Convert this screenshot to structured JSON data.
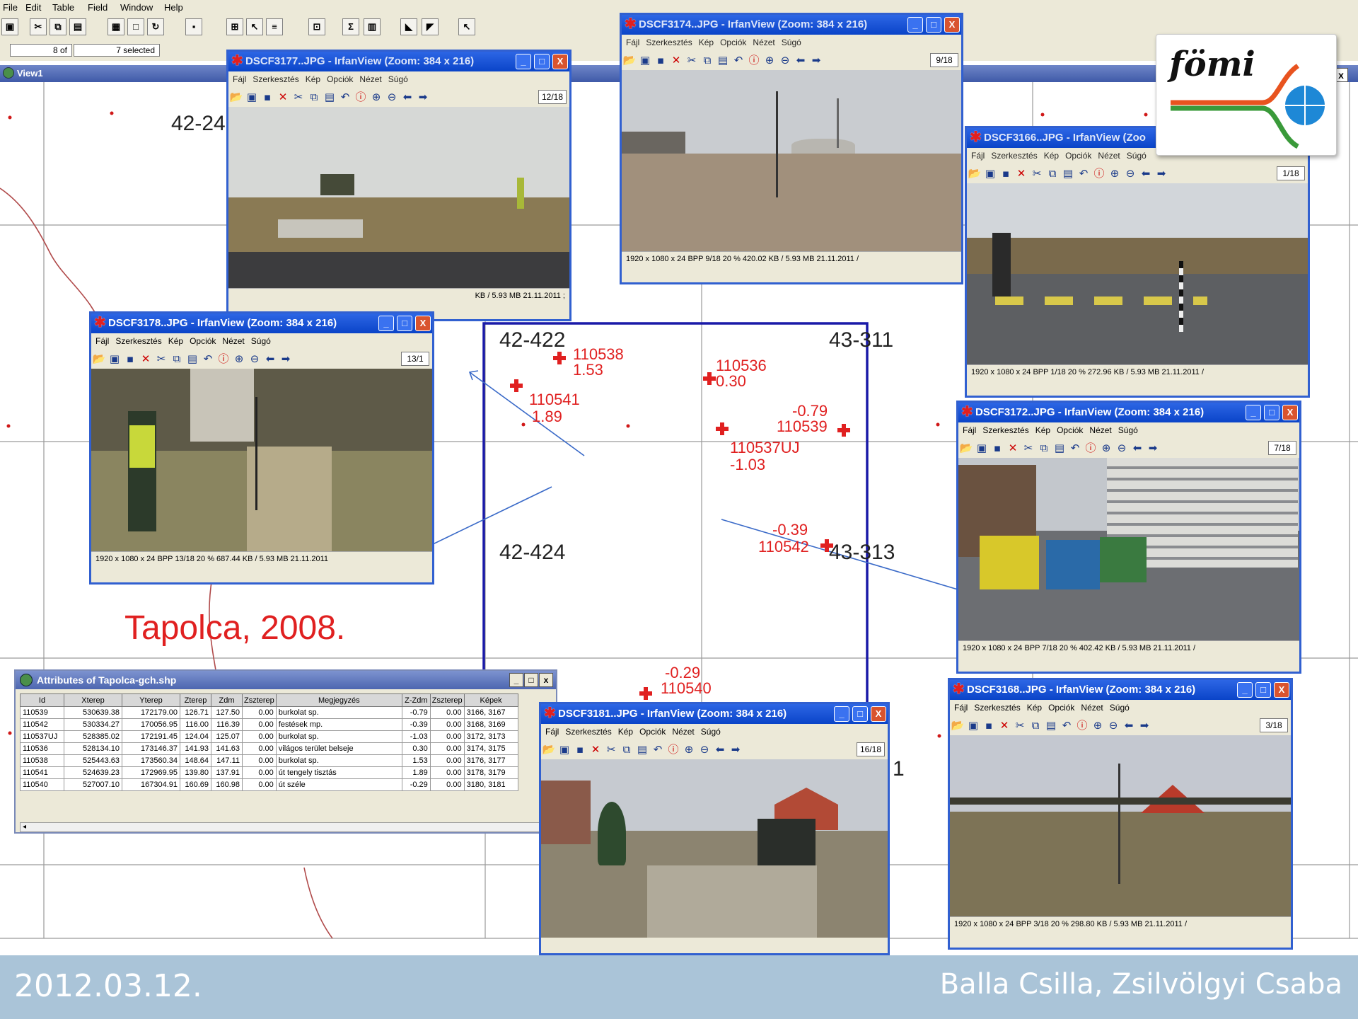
{
  "menu": {
    "file": "File",
    "edit": "Edit",
    "table": "Table",
    "field": "Field",
    "window": "Window",
    "help": "Help"
  },
  "status": {
    "count_of": "8 of",
    "selected": "7 selected"
  },
  "view1": {
    "title": "View1",
    "close": "x"
  },
  "map": {
    "sheet_labels": [
      "42-422",
      "43-311",
      "42-424",
      "43-313",
      "42-24"
    ],
    "partial_label": "1",
    "tapolca": "Tapolca, 2008.",
    "points": [
      {
        "id": "110538",
        "value": "1.53"
      },
      {
        "id": "110536",
        "value": "0.30"
      },
      {
        "id": "110541",
        "value": "1.89"
      },
      {
        "id": "110539",
        "value": "-0.79"
      },
      {
        "id": "110537UJ",
        "value": "-1.03"
      },
      {
        "id": "110542",
        "value": "-0.39"
      },
      {
        "id": "110540",
        "value": "-0.29"
      }
    ]
  },
  "irfan": {
    "menu_items": [
      "Fájl",
      "Szerkesztés",
      "Kép",
      "Opciók",
      "Nézet",
      "Súgó"
    ],
    "min": "_",
    "max": "□",
    "close": "X",
    "windows": [
      {
        "title": "DSCF3177..JPG - IrfanView (Zoom: 384 x 216)",
        "counter": "12/18",
        "status": "KB / 5.93 MB    21.11.2011 ;"
      },
      {
        "title": "DSCF3174..JPG - IrfanView (Zoom: 384 x 216)",
        "counter": "9/18",
        "status": "1920 x 1080 x 24 BPP    9/18    20 %    420.02 KB / 5.93 MB    21.11.2011 /"
      },
      {
        "title": "DSCF3166..JPG - IrfanView (Zoo",
        "counter": "1/18",
        "status": "1920 x 1080 x 24 BPP    1/18    20 %    272.96 KB / 5.93 MB    21.11.2011 /"
      },
      {
        "title": "DSCF3178..JPG - IrfanView (Zoom: 384 x 216)",
        "counter": "13/1",
        "status": "1920 x 1080 x 24 BPP    13/18    20 %    687.44 KB / 5.93 MB    21.11.2011"
      },
      {
        "title": "DSCF3172..JPG - IrfanView (Zoom: 384 x 216)",
        "counter": "7/18",
        "status": "1920 x 1080 x 24 BPP    7/18    20 %    402.42 KB / 5.93 MB    21.11.2011 /"
      },
      {
        "title": "DSCF3168..JPG - IrfanView (Zoom: 384 x 216)",
        "counter": "3/18",
        "status": "1920 x 1080 x 24 BPP    3/18    20 %    298.80 KB / 5.93 MB    21.11.2011 /"
      },
      {
        "title": "DSCF3181..JPG - IrfanView (Zoom: 384 x 216)",
        "counter": "16/18",
        "status": ""
      }
    ]
  },
  "attributes": {
    "title": "Attributes of Tapolca-gch.shp",
    "columns": [
      "Id",
      "Xterep",
      "Yterep",
      "Zterep",
      "Zdm",
      "Zszterep",
      "Megjegyzés",
      "Z-Zdm",
      "Zszterep",
      "Képek"
    ],
    "rows": [
      [
        "110539",
        "530639.38",
        "172179.00",
        "126.71",
        "127.50",
        "0.00",
        "burkolat sp.",
        "-0.79",
        "0.00",
        "3166, 3167"
      ],
      [
        "110542",
        "530334.27",
        "170056.95",
        "116.00",
        "116.39",
        "0.00",
        "festések mp.",
        "-0.39",
        "0.00",
        "3168, 3169"
      ],
      [
        "110537UJ",
        "528385.02",
        "172191.45",
        "124.04",
        "125.07",
        "0.00",
        "burkolat sp.",
        "-1.03",
        "0.00",
        "3172, 3173"
      ],
      [
        "110536",
        "528134.10",
        "173146.37",
        "141.93",
        "141.63",
        "0.00",
        "világos terület belseje",
        "0.30",
        "0.00",
        "3174, 3175"
      ],
      [
        "110538",
        "525443.63",
        "173560.34",
        "148.64",
        "147.11",
        "0.00",
        "burkolat sp.",
        "1.53",
        "0.00",
        "3176, 3177"
      ],
      [
        "110541",
        "524639.23",
        "172969.95",
        "139.80",
        "137.91",
        "0.00",
        "út tengely tisztás",
        "1.89",
        "0.00",
        "3178, 3179"
      ],
      [
        "110540",
        "527007.10",
        "167304.91",
        "160.69",
        "160.98",
        "0.00",
        "út széle",
        "-0.29",
        "0.00",
        "3180, 3181"
      ]
    ],
    "scroll_arrow": "◂"
  },
  "logo": {
    "text": "fömi"
  },
  "footer": {
    "date": "2012.03.12.",
    "authors": "Balla Csilla, Zsilvölgyi Csaba"
  },
  "colors": {
    "accent_blue": "#0a44c8",
    "point_red": "#e02020",
    "frame_navy": "#1a1aa8",
    "footer": "#aac4d8"
  }
}
